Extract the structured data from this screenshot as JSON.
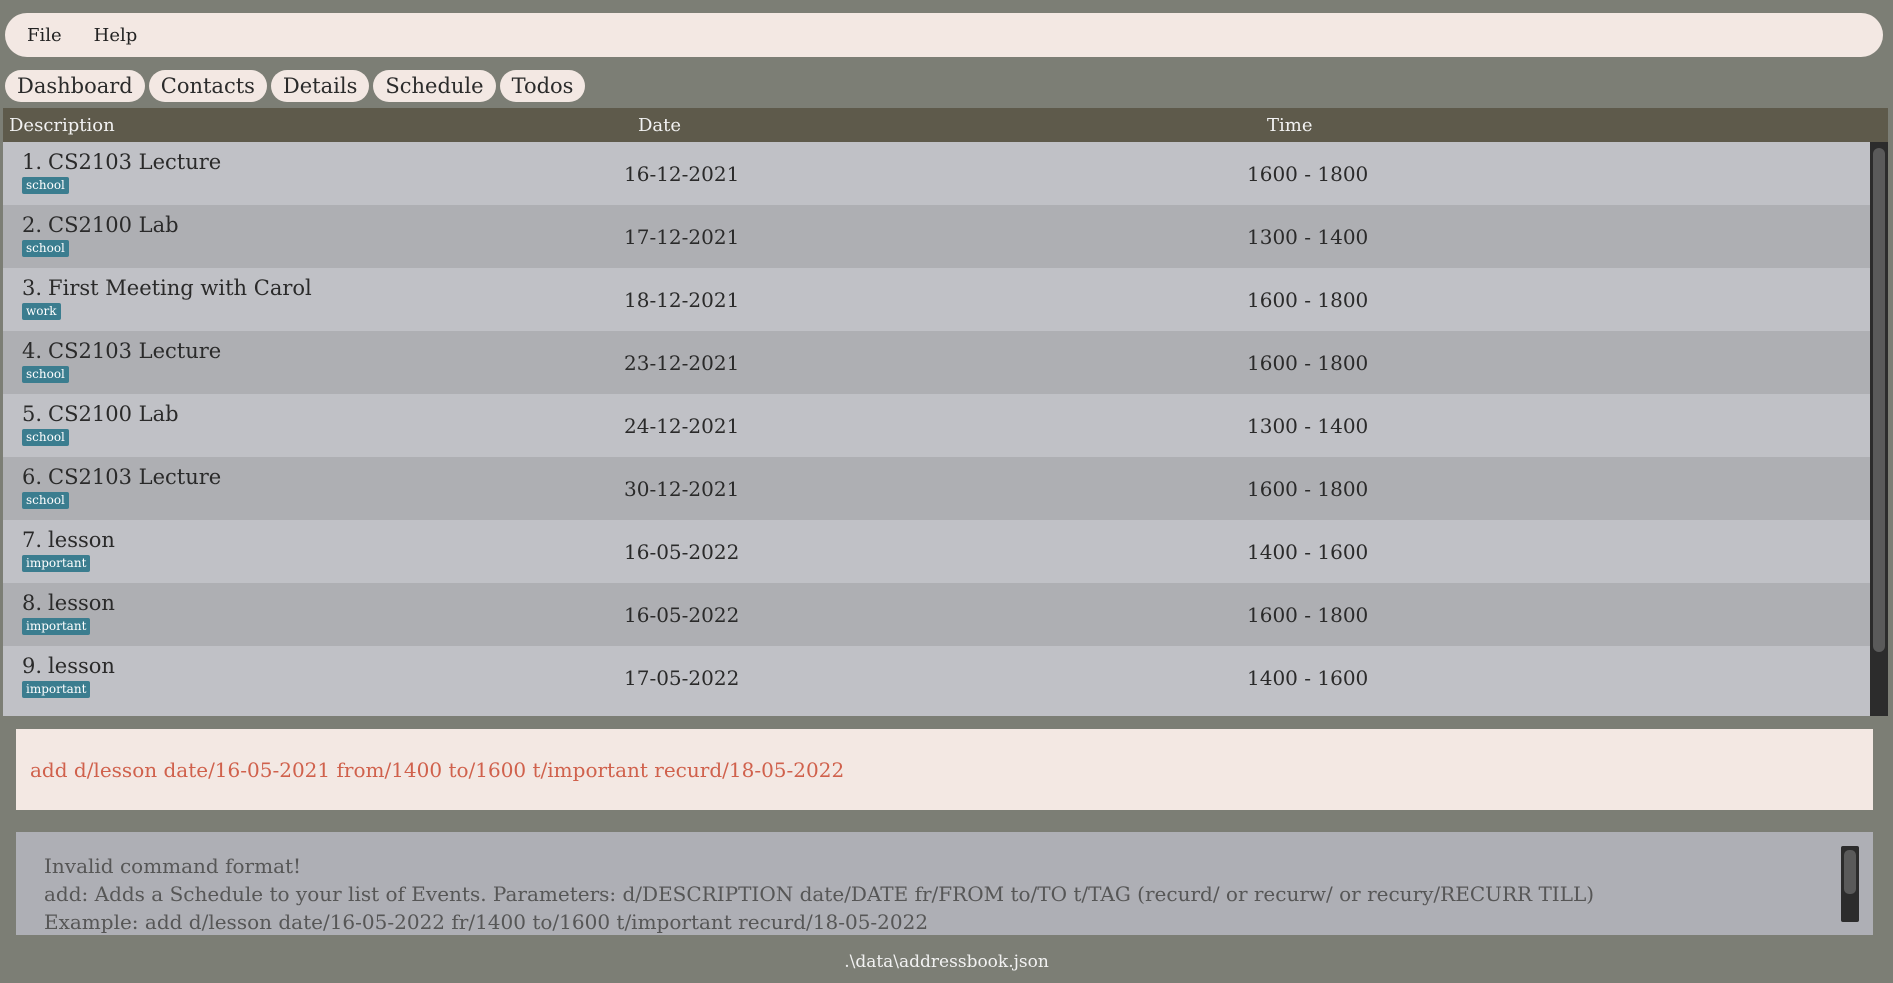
{
  "menu": {
    "items": [
      "File",
      "Help"
    ]
  },
  "tabs": [
    "Dashboard",
    "Contacts",
    "Details",
    "Schedule",
    "Todos"
  ],
  "table": {
    "headers": {
      "description": "Description",
      "date": "Date",
      "time": "Time"
    },
    "rows": [
      {
        "index": "1.",
        "description": "CS2103 Lecture",
        "tag": "school",
        "date": "16-12-2021",
        "time": "1600 - 1800"
      },
      {
        "index": "2.",
        "description": "CS2100 Lab",
        "tag": "school",
        "date": "17-12-2021",
        "time": "1300 - 1400"
      },
      {
        "index": "3.",
        "description": "First Meeting with Carol",
        "tag": "work",
        "date": "18-12-2021",
        "time": "1600 - 1800"
      },
      {
        "index": "4.",
        "description": "CS2103 Lecture",
        "tag": "school",
        "date": "23-12-2021",
        "time": "1600 - 1800"
      },
      {
        "index": "5.",
        "description": "CS2100 Lab",
        "tag": "school",
        "date": "24-12-2021",
        "time": "1300 - 1400"
      },
      {
        "index": "6.",
        "description": "CS2103 Lecture",
        "tag": "school",
        "date": "30-12-2021",
        "time": "1600 - 1800"
      },
      {
        "index": "7.",
        "description": "lesson",
        "tag": "important",
        "date": "16-05-2022",
        "time": "1400 - 1600"
      },
      {
        "index": "8.",
        "description": "lesson",
        "tag": "important",
        "date": "16-05-2022",
        "time": "1600 - 1800"
      },
      {
        "index": "9.",
        "description": "lesson",
        "tag": "important",
        "date": "17-05-2022",
        "time": "1400 - 1600"
      }
    ]
  },
  "command": {
    "value": "add d/lesson date/16-05-2021 from/1400 to/1600 t/important recurd/18-05-2022"
  },
  "result": {
    "lines": [
      "Invalid command format!",
      "add: Adds a Schedule to your list of Events. Parameters: d/DESCRIPTION date/DATE fr/FROM to/TO t/TAG (recurd/ or recurw/ or recury/RECURR TILL)",
      "Example: add d/lesson date/16-05-2022 fr/1400 to/1600 t/important recurd/18-05-2022"
    ]
  },
  "status": {
    "file_path": ".\\data\\addressbook.json"
  },
  "colors": {
    "background": "#7c7e75",
    "menu_bg": "#f3e8e3",
    "header_bg": "#5e5a4b",
    "tag_bg": "#3b7d8f",
    "command_text": "#d0614c"
  }
}
